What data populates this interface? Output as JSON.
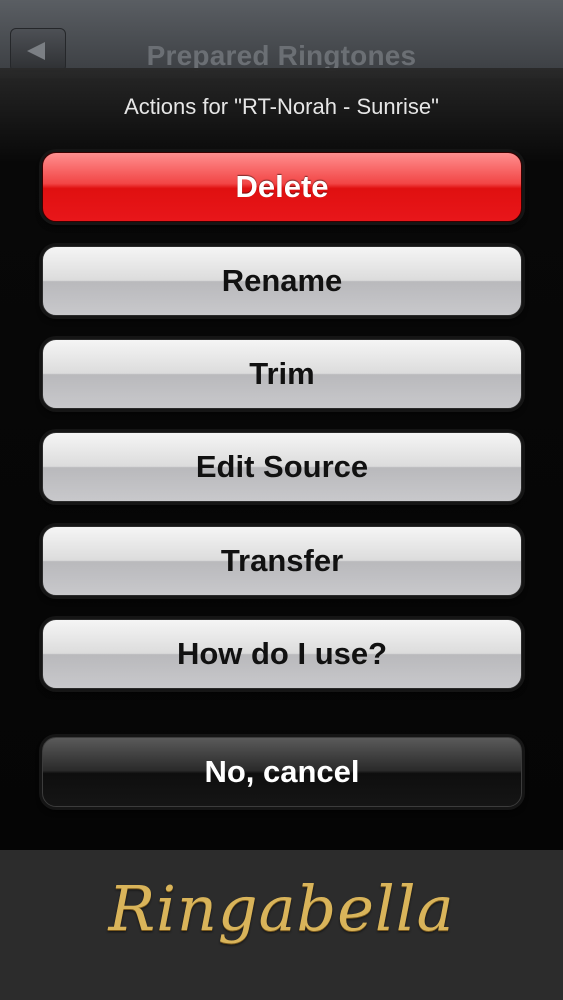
{
  "navbar": {
    "title": "Prepared Ringtones",
    "back_icon": "back-arrow-icon"
  },
  "sheet": {
    "title": "Actions for \"RT-Norah - Sunrise\"",
    "buttons": [
      {
        "label": "Delete",
        "style": "destructive",
        "color": "#e8161a"
      },
      {
        "label": "Rename",
        "style": "default"
      },
      {
        "label": "Trim",
        "style": "default"
      },
      {
        "label": "Edit Source",
        "style": "default"
      },
      {
        "label": "Transfer",
        "style": "default"
      },
      {
        "label": "How do I use?",
        "style": "default"
      }
    ],
    "cancel_label": "No, cancel"
  },
  "footer": {
    "brand": "Ringabella",
    "brand_color": "#d9b45a"
  }
}
